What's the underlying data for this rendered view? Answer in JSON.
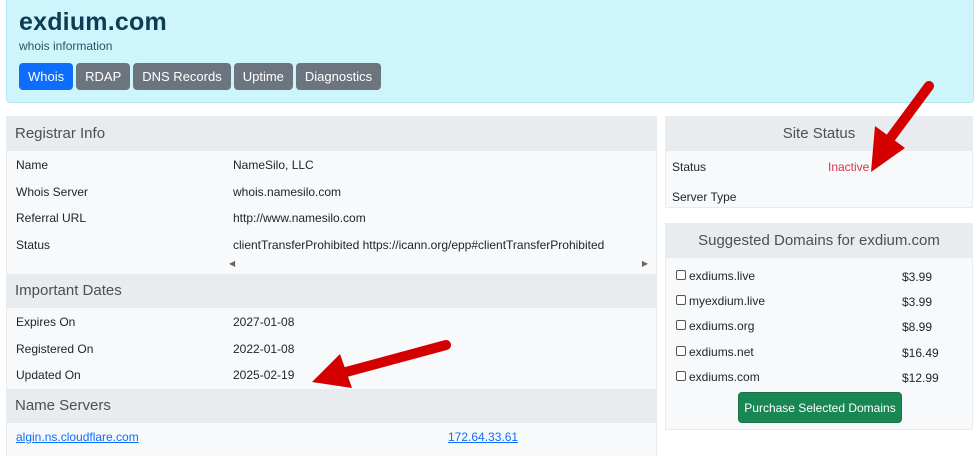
{
  "header": {
    "title": "exdium.com",
    "subtitle": "whois information",
    "tabs": [
      "Whois",
      "RDAP",
      "DNS Records",
      "Uptime",
      "Diagnostics"
    ]
  },
  "registrar": {
    "heading": "Registrar Info",
    "rows": [
      {
        "label": "Name",
        "value": "NameSilo, LLC"
      },
      {
        "label": "Whois Server",
        "value": "whois.namesilo.com"
      },
      {
        "label": "Referral URL",
        "value": "http://www.namesilo.com"
      },
      {
        "label": "Status",
        "value": "clientTransferProhibited https://icann.org/epp#clientTransferProhibited"
      }
    ]
  },
  "dates": {
    "heading": "Important Dates",
    "rows": [
      {
        "label": "Expires On",
        "value": "2027-01-08"
      },
      {
        "label": "Registered On",
        "value": "2022-01-08"
      },
      {
        "label": "Updated On",
        "value": "2025-02-19"
      }
    ]
  },
  "nameservers": {
    "heading": "Name Servers",
    "host": "algin.ns.cloudflare.com",
    "ip": "172.64.33.61"
  },
  "site_status": {
    "heading": "Site Status",
    "status_label": "Status",
    "status_value": "Inactive",
    "server_type_label": "Server Type"
  },
  "suggested": {
    "heading": "Suggested Domains for exdium.com",
    "items": [
      {
        "name": "exdiums.live",
        "price": "$3.99"
      },
      {
        "name": "myexdium.live",
        "price": "$3.99"
      },
      {
        "name": "exdiums.org",
        "price": "$8.99"
      },
      {
        "name": "exdiums.net",
        "price": "$16.49"
      },
      {
        "name": "exdiums.com",
        "price": "$12.99"
      }
    ],
    "button_label": "Purchase Selected Domains"
  },
  "colors": {
    "header_bg": "#cef4fc",
    "tab_active": "#0d6efd",
    "tab_inactive": "#6c757d",
    "inactive_status": "#dc3545",
    "purchase_button": "#198754",
    "annotation_arrow": "#d40000"
  }
}
